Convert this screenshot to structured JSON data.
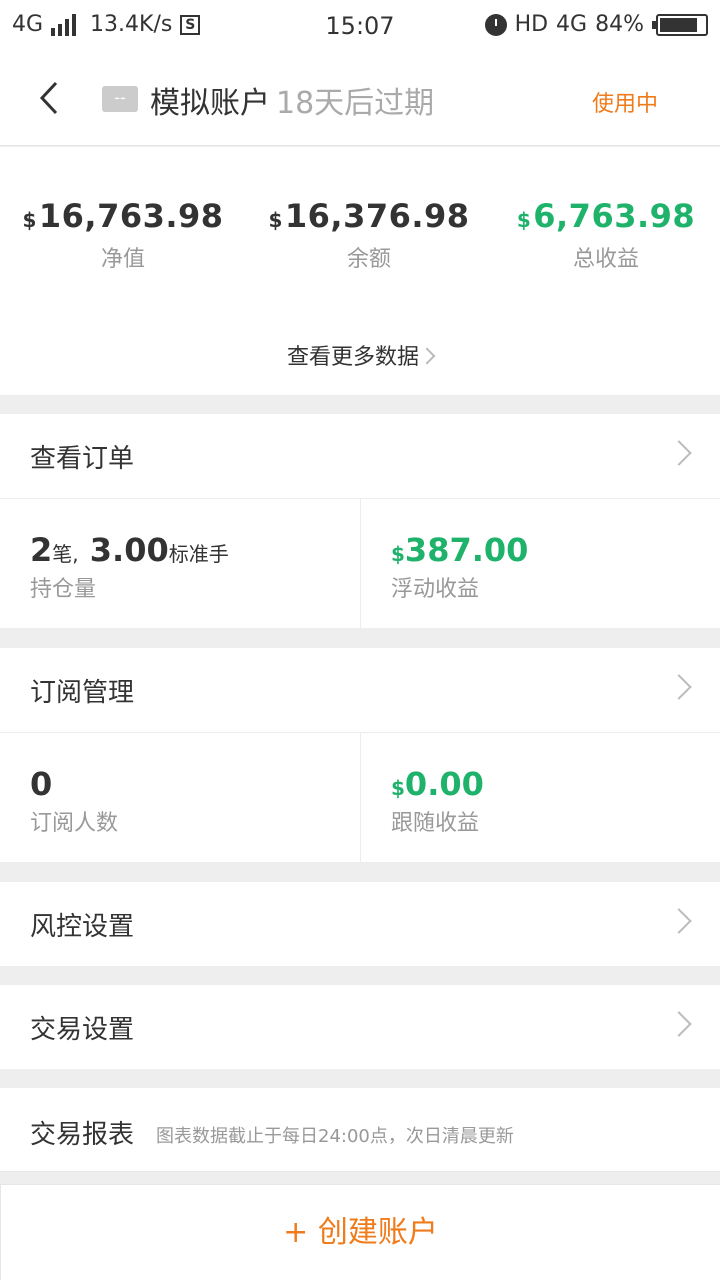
{
  "status_bar": {
    "network": "4G",
    "speed": "13.4K/s",
    "speed_icon": "S",
    "time": "15:07",
    "hd": "HD",
    "net2": "4G",
    "battery": "84%",
    "battery_level": 0.84
  },
  "header": {
    "badge": "--",
    "account_name": "模拟账户",
    "expire_text": "18天后过期",
    "status": "使用中"
  },
  "summary": {
    "currency": "$",
    "net_value": "16,763.98",
    "net_value_label": "净值",
    "balance": "16,376.98",
    "balance_label": "余额",
    "total_profit": "6,763.98",
    "total_profit_label": "总收益",
    "more_link": "查看更多数据"
  },
  "orders": {
    "title": "查看订单",
    "position_count": "2",
    "position_count_unit": "笔,",
    "position_lots": "3.00",
    "position_lots_unit": "标准手",
    "position_label": "持仓量",
    "floating_profit": "387.00",
    "floating_profit_label": "浮动收益"
  },
  "subscription": {
    "title": "订阅管理",
    "subscribers": "0",
    "subscribers_label": "订阅人数",
    "follow_profit": "0.00",
    "follow_profit_label": "跟随收益"
  },
  "risk": {
    "title": "风控设置"
  },
  "trade_settings": {
    "title": "交易设置"
  },
  "report": {
    "title": "交易报表",
    "note": "图表数据截止于每日24:00点，次日清晨更新"
  },
  "create_button": "+ 创建账户",
  "colors": {
    "accent": "#f07b1b",
    "profit": "#1fb26b"
  }
}
